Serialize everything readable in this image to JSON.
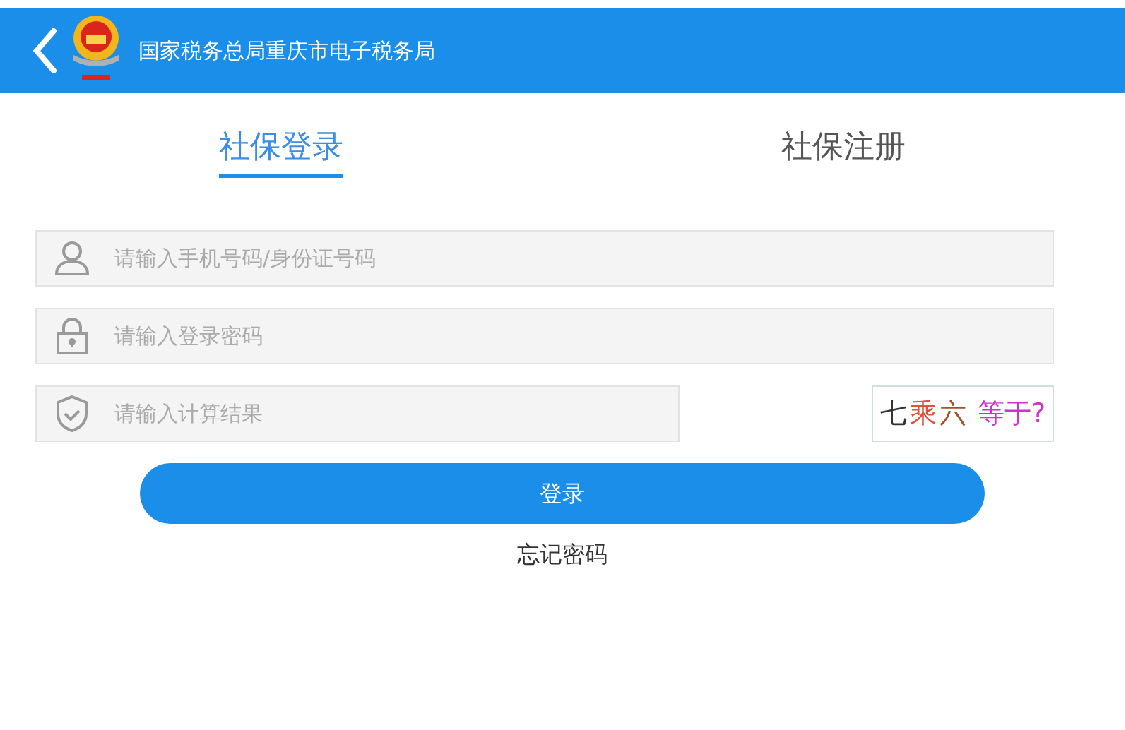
{
  "header": {
    "title": "国家税务总局重庆市电子税务局"
  },
  "tabs": [
    {
      "label": "社保登录",
      "selected": true
    },
    {
      "label": "社保注册",
      "selected": false
    }
  ],
  "fields": [
    {
      "kind": "user",
      "placeholder": "请输入手机号码/身份证号码"
    },
    {
      "kind": "password",
      "placeholder": "请输入登录密码"
    },
    {
      "kind": "captcha",
      "placeholder": "请输入计算结果"
    }
  ],
  "captcha": {
    "parts": [
      {
        "text": "七",
        "color": "#333333"
      },
      {
        "text": "乘",
        "color": "#e0533a"
      },
      {
        "text": "六",
        "color": "#a0522d"
      },
      {
        "text": "等于?",
        "color": "#cc33cc"
      }
    ]
  },
  "login_button": "登录",
  "forgot_link": "忘记密码"
}
